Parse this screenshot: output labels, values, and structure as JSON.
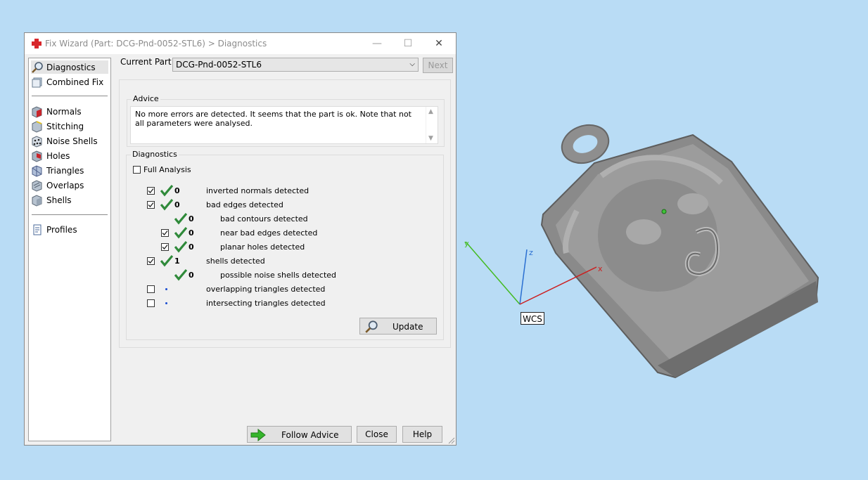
{
  "window": {
    "title": "Fix Wizard (Part: DCG-Pnd-0052-STL6) > Diagnostics",
    "controls": {
      "minimize": "—",
      "maximize": "☐",
      "close": "✕"
    }
  },
  "sidebar": {
    "groups": [
      [
        {
          "label": "Diagnostics",
          "icon": "magnifier-icon",
          "selected": true
        },
        {
          "label": "Combined Fix",
          "icon": "combined-fix-icon"
        }
      ],
      [
        {
          "label": "Normals",
          "icon": "normals-icon"
        },
        {
          "label": "Stitching",
          "icon": "stitching-icon"
        },
        {
          "label": "Noise Shells",
          "icon": "noise-shells-icon"
        },
        {
          "label": "Holes",
          "icon": "holes-icon"
        },
        {
          "label": "Triangles",
          "icon": "triangles-icon"
        },
        {
          "label": "Overlaps",
          "icon": "overlaps-icon"
        },
        {
          "label": "Shells",
          "icon": "shells-icon"
        }
      ],
      [
        {
          "label": "Profiles",
          "icon": "profiles-icon"
        }
      ]
    ]
  },
  "current_part": {
    "label": "Current Part:",
    "value": "DCG-Pnd-0052-STL6"
  },
  "next_button": "Next",
  "advice": {
    "title": "Advice",
    "text": "No more errors are detected. It seems that the part is ok. Note that not all parameters were analysed."
  },
  "diagnostics": {
    "title": "Diagnostics",
    "full_analysis": {
      "label": "Full Analysis",
      "checked": false
    },
    "rows": [
      {
        "checkbox": true,
        "checked": true,
        "status": "ok",
        "count": "0",
        "label": "inverted normals detected",
        "indent": 0
      },
      {
        "checkbox": true,
        "checked": true,
        "status": "ok",
        "count": "0",
        "label": "bad edges detected",
        "indent": 0
      },
      {
        "checkbox": false,
        "checked": false,
        "status": "ok",
        "count": "0",
        "label": "bad contours detected",
        "indent": 1
      },
      {
        "checkbox": true,
        "checked": true,
        "status": "ok",
        "count": "0",
        "label": "near bad edges detected",
        "indent": 1
      },
      {
        "checkbox": true,
        "checked": true,
        "status": "ok",
        "count": "0",
        "label": "planar holes detected",
        "indent": 1
      },
      {
        "checkbox": true,
        "checked": true,
        "status": "ok",
        "count": "1",
        "label": "shells detected",
        "indent": 0
      },
      {
        "checkbox": false,
        "checked": false,
        "status": "ok",
        "count": "0",
        "label": "possible noise shells detected",
        "indent": 1
      },
      {
        "checkbox": true,
        "checked": false,
        "status": "pending",
        "count": "",
        "label": "overlapping triangles detected",
        "indent": 0
      },
      {
        "checkbox": true,
        "checked": false,
        "status": "pending",
        "count": "",
        "label": "intersecting triangles detected",
        "indent": 0
      }
    ],
    "update_button": "Update"
  },
  "footer": {
    "follow_advice": "Follow Advice",
    "close": "Close",
    "help": "Help"
  },
  "viewport": {
    "wcs_label": "WCS",
    "axes": {
      "x": "x",
      "y": "y",
      "z": "z"
    },
    "colors": {
      "x_axis": "#cc1f1f",
      "y_axis": "#44bb22",
      "z_axis": "#2a6fd1",
      "model": "#8e8e8e",
      "background": "#b9dcf5"
    }
  }
}
